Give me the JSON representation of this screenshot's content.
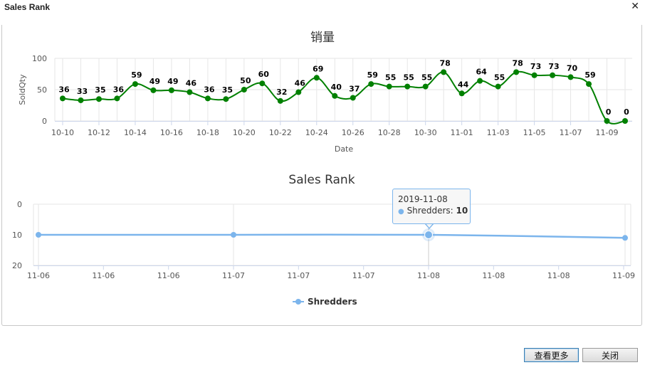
{
  "window": {
    "title": "Sales Rank",
    "close_glyph": "✕"
  },
  "buttons": {
    "more": "查看更多",
    "close": "关闭"
  },
  "tooltip": {
    "date": "2019-11-08",
    "series": "Shredders",
    "value": "10"
  },
  "colors": {
    "sold_line": "#008000",
    "rank_line": "#7cb5ec",
    "grid": "#e6e6e6",
    "axis": "#ccd6eb"
  },
  "chart_data": [
    {
      "type": "line",
      "title": "销量",
      "xlabel": "Date",
      "ylabel": "SoldQty",
      "ylim": [
        0,
        100
      ],
      "yticks": [
        0,
        50,
        100
      ],
      "grid": true,
      "legend": "none",
      "x": [
        "10-10",
        "10-11",
        "10-12",
        "10-13",
        "10-14",
        "10-15",
        "10-16",
        "10-17",
        "10-18",
        "10-19",
        "10-20",
        "10-21",
        "10-22",
        "10-23",
        "10-24",
        "10-25",
        "10-26",
        "10-27",
        "10-28",
        "10-29",
        "10-30",
        "10-31",
        "11-01",
        "11-02",
        "11-03",
        "11-04",
        "11-05",
        "11-06",
        "11-07",
        "11-08",
        "11-09",
        "11-10"
      ],
      "xticks": [
        "10-10",
        "10-12",
        "10-14",
        "10-16",
        "10-18",
        "10-20",
        "10-22",
        "10-24",
        "10-26",
        "10-28",
        "10-30",
        "11-01",
        "11-03",
        "11-05",
        "11-07",
        "11-09"
      ],
      "values": [
        36,
        33,
        35,
        36,
        59,
        49,
        49,
        46,
        36,
        35,
        50,
        60,
        32,
        46,
        69,
        40,
        37,
        59,
        55,
        55,
        55,
        78,
        44,
        64,
        55,
        78,
        73,
        73,
        70,
        59,
        0,
        0
      ]
    },
    {
      "type": "line",
      "title": "Sales Rank",
      "xlabel": "",
      "ylabel": "",
      "ylim": [
        0,
        20
      ],
      "reversed": true,
      "yticks": [
        0,
        10,
        20
      ],
      "grid": true,
      "legend": "bottom-center",
      "xticks": [
        "11-06",
        "11-06",
        "11-06",
        "11-07",
        "11-07",
        "11-07",
        "11-08",
        "11-08",
        "11-08",
        "11-09"
      ],
      "series": [
        {
          "name": "Shredders",
          "x": [
            "2019-11-06",
            "2019-11-07",
            "2019-11-08",
            "2019-11-09"
          ],
          "values": [
            10,
            10,
            10,
            11
          ]
        }
      ]
    }
  ]
}
